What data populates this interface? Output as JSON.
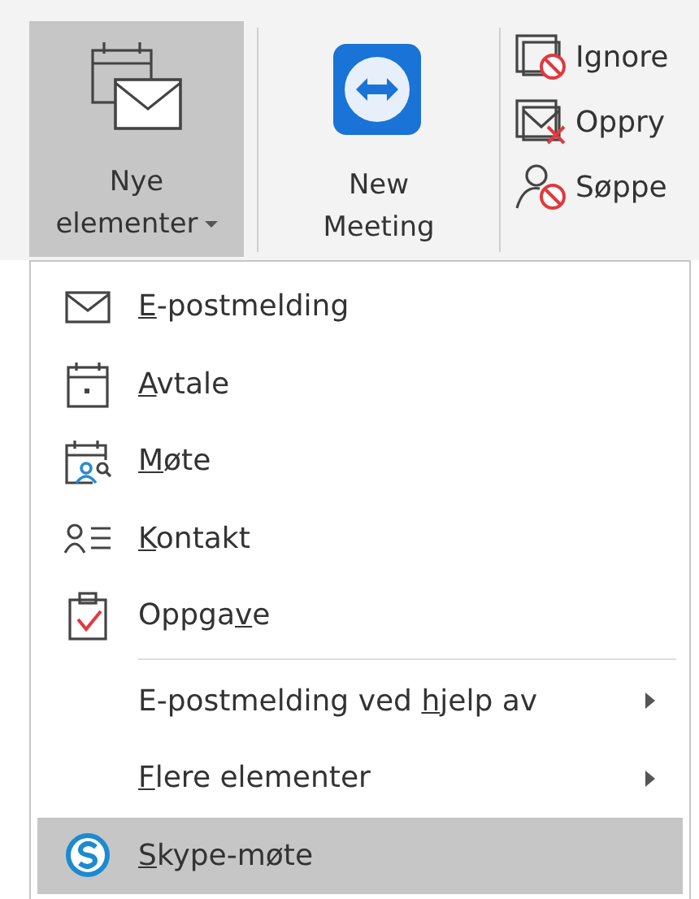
{
  "ribbon": {
    "large_buttons": [
      {
        "label_lines": [
          "Nye",
          "elementer"
        ],
        "dropdown": true,
        "selected": true
      },
      {
        "label_lines": [
          "New",
          "Meeting"
        ],
        "dropdown": false,
        "selected": false
      }
    ],
    "small_buttons": [
      {
        "label": "Ignore"
      },
      {
        "label": "Oppry"
      },
      {
        "label": "Søppe"
      }
    ]
  },
  "menu": {
    "items": [
      {
        "kind": "item",
        "access_key": "E",
        "label_after": "-postmelding",
        "has_submenu": false,
        "selected": false
      },
      {
        "kind": "item",
        "access_key": "A",
        "label_after": "vtale",
        "has_submenu": false,
        "selected": false
      },
      {
        "kind": "item",
        "access_key": "M",
        "label_after": "øte",
        "has_submenu": false,
        "selected": false
      },
      {
        "kind": "item",
        "access_key": "K",
        "label_after": "ontakt",
        "has_submenu": false,
        "selected": false
      },
      {
        "kind": "item",
        "label_before": "Oppga",
        "access_key": "v",
        "label_after": "e",
        "has_submenu": false,
        "selected": false
      },
      {
        "kind": "separator"
      },
      {
        "kind": "item",
        "label_before": "E-postmelding ved ",
        "access_key": "h",
        "label_after": "jelp av",
        "has_submenu": true,
        "selected": false
      },
      {
        "kind": "item",
        "access_key": "F",
        "label_after": "lere elementer",
        "has_submenu": true,
        "selected": false
      },
      {
        "kind": "item",
        "access_key": "S",
        "label_after": "kype-møte",
        "has_submenu": false,
        "selected": true
      }
    ]
  }
}
